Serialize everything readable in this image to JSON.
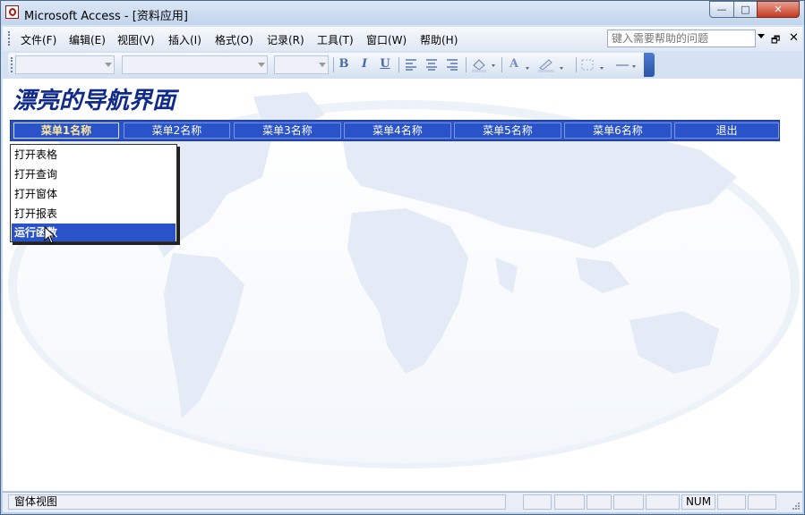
{
  "window": {
    "title": "Microsoft Access - [资料应用]",
    "minimize_glyph": "—",
    "maximize_glyph": "□",
    "close_glyph": "✕"
  },
  "menubar": {
    "items": [
      "文件(F)",
      "编辑(E)",
      "视图(V)",
      "插入(I)",
      "格式(O)",
      "记录(R)",
      "工具(T)",
      "窗口(W)",
      "帮助(H)"
    ],
    "help_placeholder": "键入需要帮助的问题",
    "mdi_restore_glyph": "🗗",
    "mdi_close_glyph": "✕"
  },
  "toolbar": {
    "bold": "B",
    "italic": "I",
    "underline": "U",
    "font_color": "A"
  },
  "form": {
    "title": "漂亮的导航界面",
    "nav_buttons": [
      "菜单1名称",
      "菜单2名称",
      "菜单3名称",
      "菜单4名称",
      "菜单5名称",
      "菜单6名称",
      "退出"
    ],
    "dropdown_items": [
      "打开表格",
      "打开查询",
      "打开窗体",
      "打开报表",
      "运行函数"
    ]
  },
  "statusbar": {
    "view": "窗体视图",
    "num": "NUM"
  },
  "colors": {
    "nav_blue": "#2b53c9",
    "title_blue": "#102a8c",
    "map_fill": "#e4ebf6"
  }
}
